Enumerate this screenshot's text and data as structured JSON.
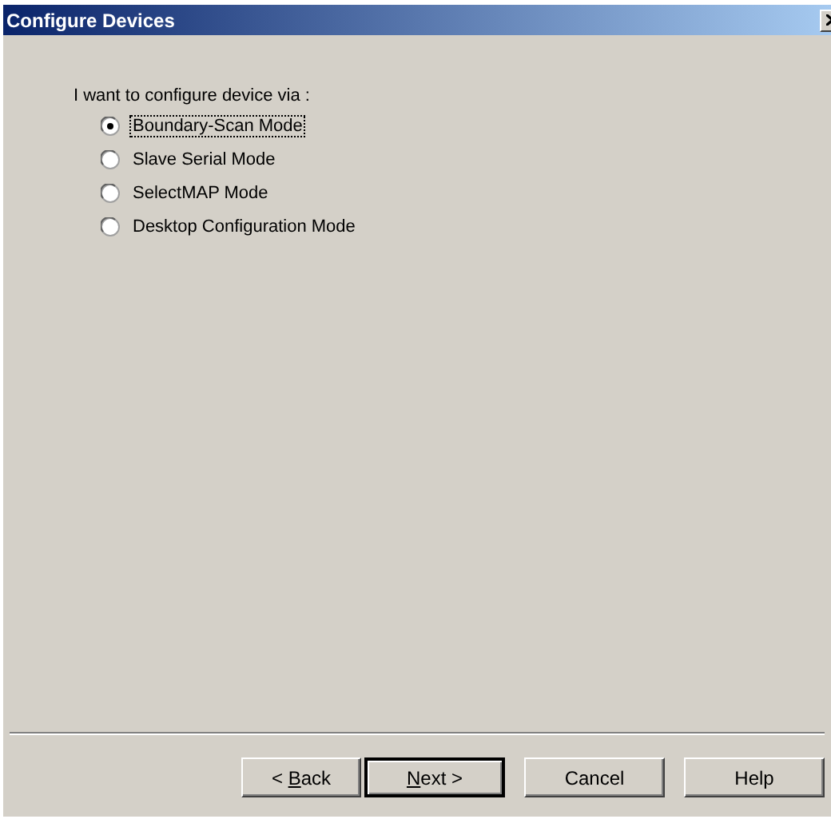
{
  "window": {
    "title": "Configure Devices"
  },
  "prompt": "I want to configure device via :",
  "options": [
    {
      "label": "Boundary-Scan Mode",
      "selected": true,
      "focused": true
    },
    {
      "label": "Slave Serial Mode",
      "selected": false,
      "focused": false
    },
    {
      "label": "SelectMAP Mode",
      "selected": false,
      "focused": false
    },
    {
      "label": "Desktop Configuration Mode",
      "selected": false,
      "focused": false
    }
  ],
  "buttons": [
    {
      "label": {
        "before": "< ",
        "access_key": "B",
        "after": "ack"
      },
      "default": false
    },
    {
      "label": {
        "access_key": "N",
        "after": "ext >"
      },
      "default": true
    },
    {
      "label": "Cancel",
      "default": false
    },
    {
      "label": "Help",
      "default": false
    }
  ]
}
